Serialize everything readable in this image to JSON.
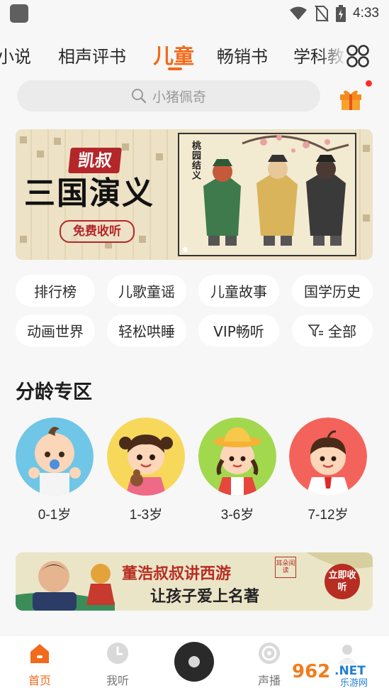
{
  "status": {
    "time": "4:33"
  },
  "tabs": [
    {
      "label": "小说"
    },
    {
      "label": "相声评书"
    },
    {
      "label": "儿童"
    },
    {
      "label": "畅销书"
    },
    {
      "label": "学科教"
    }
  ],
  "active_tab": "儿童",
  "search": {
    "placeholder": "小猪佩奇"
  },
  "banner": {
    "author": "凯叔",
    "title": "三国演义",
    "cta": "免费收听",
    "caption": "桃园结义"
  },
  "categories": [
    {
      "label": "排行榜"
    },
    {
      "label": "儿歌童谣"
    },
    {
      "label": "儿童故事"
    },
    {
      "label": "国学历史"
    },
    {
      "label": "动画世界"
    },
    {
      "label": "轻松哄睡"
    },
    {
      "label": "VIP畅听"
    },
    {
      "label": "全部",
      "icon": "filter-icon"
    }
  ],
  "age_section": {
    "title": "分龄专区",
    "groups": [
      {
        "label": "0-1岁",
        "color": "#6fc6e6"
      },
      {
        "label": "1-3岁",
        "color": "#f7d85a"
      },
      {
        "label": "3-6岁",
        "color": "#a2d84e"
      },
      {
        "label": "7-12岁",
        "color": "#f4635b"
      }
    ]
  },
  "promo": {
    "line1": "董浩叔叔讲西游",
    "line2": "让孩子爱上名著",
    "cta": "立即收听",
    "stamp": "耳朵阅读"
  },
  "bottom_nav": [
    {
      "label": "首页",
      "icon": "home-icon"
    },
    {
      "label": "我听",
      "icon": "clock-icon"
    },
    {
      "label": "",
      "icon": "disc-player-icon"
    },
    {
      "label": "声播",
      "icon": "broadcast-icon"
    },
    {
      "label": "",
      "icon": "profile-icon"
    }
  ],
  "watermark": {
    "number": "962",
    "suffix": ".NET",
    "sub": "乐游网"
  },
  "colors": {
    "accent": "#f26a1b",
    "background": "#f7f7f7",
    "chip": "#ffffff",
    "banner_red": "#b3262a"
  }
}
